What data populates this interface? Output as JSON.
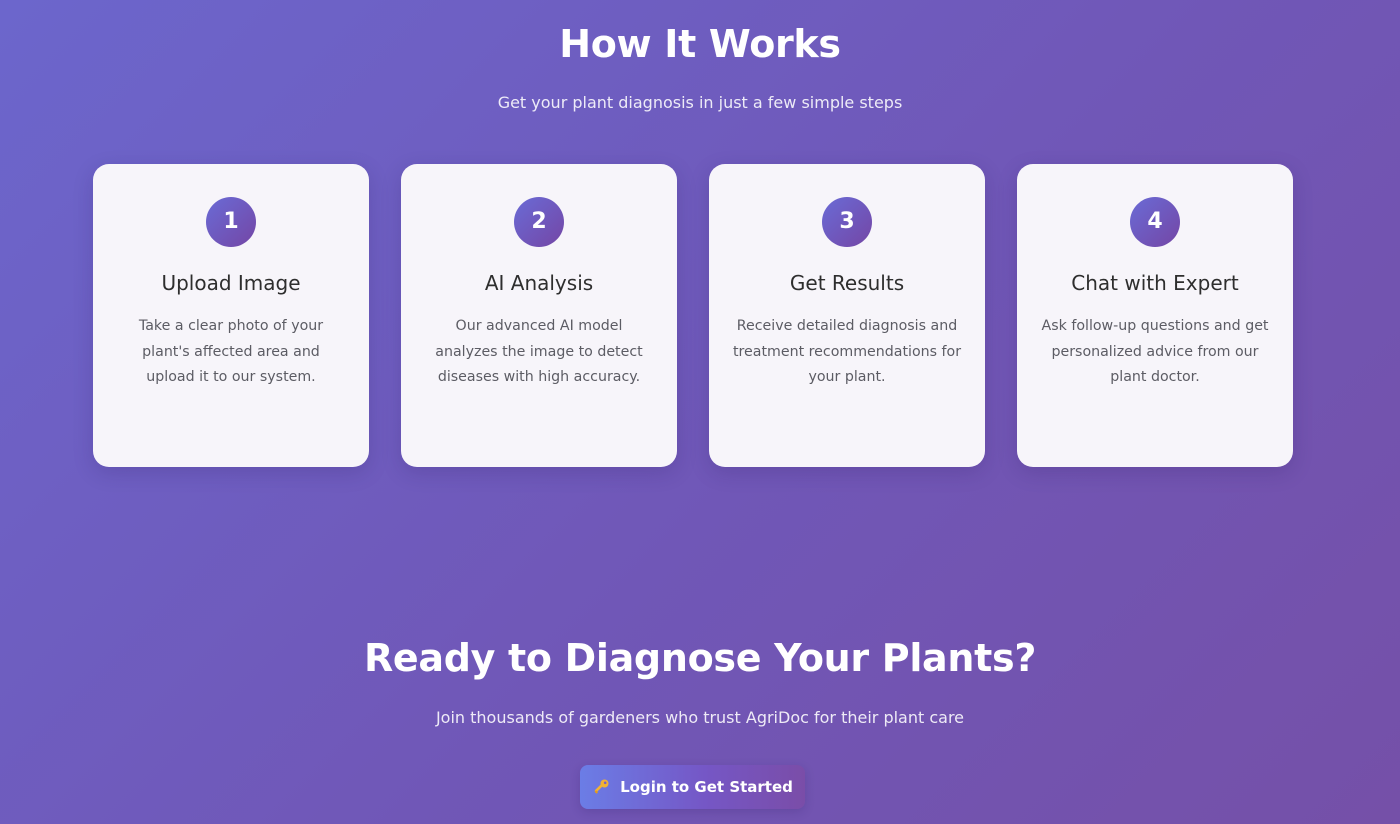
{
  "how_it_works": {
    "title": "How It Works",
    "subtitle": "Get your plant diagnosis in just a few simple steps",
    "steps": [
      {
        "number": "1",
        "title": "Upload Image",
        "description": "Take a clear photo of your plant's affected area and upload it to our system."
      },
      {
        "number": "2",
        "title": "AI Analysis",
        "description": "Our advanced AI model analyzes the image to detect diseases with high accuracy."
      },
      {
        "number": "3",
        "title": "Get Results",
        "description": "Receive detailed diagnosis and treatment recommendations for your plant."
      },
      {
        "number": "4",
        "title": "Chat with Expert",
        "description": "Ask follow-up questions and get personalized advice from our plant doctor."
      }
    ]
  },
  "cta": {
    "title": "Ready to Diagnose Your Plants?",
    "subtitle": "Join thousands of gardeners who trust AgriDoc for their plant care",
    "button_label": "Login to Get Started",
    "button_icon": "key-icon"
  },
  "colors": {
    "background_start": "#6c66cc",
    "background_end": "#7550a8",
    "card_background": "#f7f5fa",
    "badge_start": "#6a6bd6",
    "badge_end": "#7446a5",
    "card_title": "#2e2e2e",
    "card_text": "#5c5c64"
  }
}
